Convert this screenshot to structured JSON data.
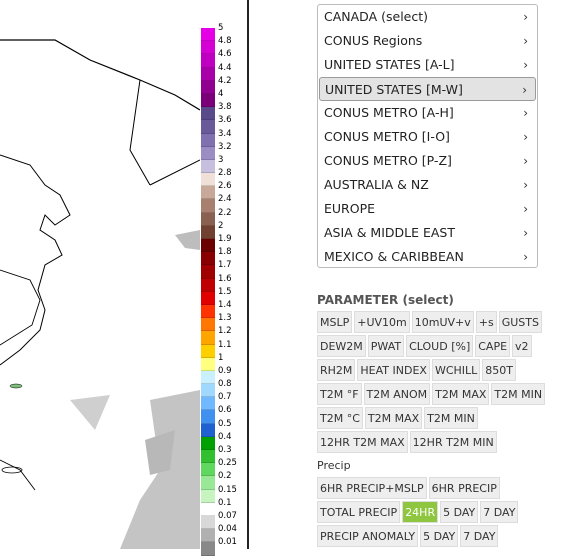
{
  "colorbar": {
    "labels": [
      "5",
      "4.8",
      "4.6",
      "4.4",
      "4.2",
      "4",
      "3.8",
      "3.6",
      "3.4",
      "3.2",
      "3",
      "2.8",
      "2.6",
      "2.4",
      "2.2",
      "2",
      "1.9",
      "1.8",
      "1.7",
      "1.6",
      "1.5",
      "1.4",
      "1.3",
      "1.2",
      "1.1",
      "1",
      "0.9",
      "0.8",
      "0.7",
      "0.6",
      "0.5",
      "0.4",
      "0.3",
      "0.25",
      "0.2",
      "0.15",
      "0.1",
      "0.07",
      "0.04",
      "0.01"
    ],
    "colors": [
      "#e600e6",
      "#d400d4",
      "#c000c0",
      "#a800a8",
      "#900090",
      "#7a007a",
      "#5a4a8a",
      "#6a5a9a",
      "#8070b0",
      "#9c8cc4",
      "#c8bede",
      "#f0e0d8",
      "#c8a898",
      "#a88070",
      "#8a6050",
      "#704030",
      "#6a0000",
      "#880000",
      "#a00000",
      "#c00000",
      "#e00000",
      "#ff3300",
      "#ff7700",
      "#ffa500",
      "#ffd000",
      "#ffff80",
      "#c8f0ff",
      "#a0d8ff",
      "#70b8ff",
      "#4090f0",
      "#2060d0",
      "#00a000",
      "#30c030",
      "#60d860",
      "#98e898",
      "#c8f4c0",
      "#ffffff",
      "#d8d8d8",
      "#b0b0b0",
      "#888888"
    ]
  },
  "menu": {
    "items": [
      {
        "label": "CANADA (select)",
        "selected": false
      },
      {
        "label": "CONUS Regions",
        "selected": false
      },
      {
        "label": "UNITED STATES [A-L]",
        "selected": false
      },
      {
        "label": "UNITED STATES [M-W]",
        "selected": true
      },
      {
        "label": "CONUS METRO [A-H]",
        "selected": false
      },
      {
        "label": "CONUS METRO [I-O]",
        "selected": false
      },
      {
        "label": "CONUS METRO [P-Z]",
        "selected": false
      },
      {
        "label": "AUSTRALIA & NZ",
        "selected": false
      },
      {
        "label": "EUROPE",
        "selected": false
      },
      {
        "label": "ASIA & MIDDLE EAST",
        "selected": false
      },
      {
        "label": "MEXICO & CARIBBEAN",
        "selected": false
      }
    ],
    "arrow_glyph": "›"
  },
  "parameter": {
    "title": "PARAMETER",
    "select_label": "(select)",
    "rows": [
      [
        "MSLP",
        "+UV10m",
        "10mUV+v",
        "+s",
        "GUSTS"
      ],
      [
        "DEW2M",
        "PWAT",
        "CLOUD [%]",
        "CAPE",
        "v2"
      ],
      [
        "RH2M",
        "HEAT INDEX",
        "WCHILL",
        "850T"
      ],
      [
        "T2M °F",
        "T2M ANOM",
        "T2M MAX",
        "T2M MIN"
      ],
      [
        "T2M °C",
        "T2M MAX",
        "T2M MIN"
      ],
      [
        "12HR T2M MAX",
        "12HR T2M MIN"
      ]
    ],
    "precip_label": "Precip",
    "precip_rows": [
      [
        "6HR PRECIP+MSLP",
        "6HR PRECIP"
      ],
      [
        "TOTAL PRECIP",
        "24HR",
        "5 DAY",
        "7 DAY"
      ],
      [
        "PRECIP ANOMALY",
        "5 DAY",
        "7 DAY"
      ]
    ],
    "active_button": "24HR",
    "active_color": "#8ec63f"
  }
}
